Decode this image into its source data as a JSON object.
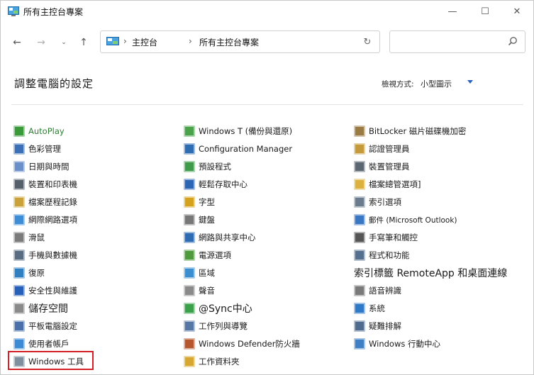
{
  "window": {
    "title": "所有主控台專案",
    "min_glyph": "—",
    "max_glyph": "☐",
    "close_glyph": "✕"
  },
  "nav": {
    "back_glyph": "←",
    "forward_glyph": "→",
    "recent_glyph": "⌄",
    "up_glyph": "↑",
    "breadcrumb": [
      "主控台",
      "所有主控台專案"
    ],
    "separator": "›",
    "refresh_glyph": "↻",
    "search_placeholder": ""
  },
  "header": {
    "title": "調整電腦的設定",
    "view_by_label": "檢視方式:",
    "view_by_value": "小型圖示"
  },
  "columns": [
    [
      {
        "label": "AutoPlay",
        "icon": "autoplay-icon",
        "color": "#3a9a3a",
        "style": "green"
      },
      {
        "label": "色彩管理",
        "icon": "color-management-icon",
        "color": "#3b6fb6"
      },
      {
        "label": "日期與時間",
        "icon": "clock-icon",
        "color": "#6a8fc9"
      },
      {
        "label": "裝置和印表機",
        "icon": "printer-icon",
        "color": "#55606b"
      },
      {
        "label": "檔案歷程記錄",
        "icon": "file-history-icon",
        "color": "#c9a23a"
      },
      {
        "label": "網際網路選項",
        "icon": "internet-options-icon",
        "color": "#3c8dd6"
      },
      {
        "label": "滑鼠",
        "icon": "mouse-icon",
        "color": "#7b7b7b"
      },
      {
        "label": "手機與數據機",
        "icon": "phone-modem-icon",
        "color": "#5a6c82"
      },
      {
        "label": "復原",
        "icon": "recovery-icon",
        "color": "#2f7fc1"
      },
      {
        "label": "安全性與維護",
        "icon": "flag-icon",
        "color": "#2660b8"
      },
      {
        "label": "儲存空間",
        "icon": "storage-icon",
        "color": "#8a8a8a",
        "style": "big"
      },
      {
        "label": "平板電腦設定",
        "icon": "tablet-icon",
        "color": "#4b6fa8"
      },
      {
        "label": "使用者帳戶",
        "icon": "user-accounts-icon",
        "color": "#3d8bd4"
      },
      {
        "label": "Windows 工具",
        "icon": "windows-tools-icon",
        "color": "#7f8f9e"
      }
    ],
    [
      {
        "label": "Windows T (備份與還原)",
        "icon": "backup-restore-icon",
        "color": "#4aa24a"
      },
      {
        "label": "Configuration Manager",
        "icon": "configuration-manager-icon",
        "color": "#2f6db3"
      },
      {
        "label": "預設程式",
        "icon": "default-programs-icon",
        "color": "#3f9a4a"
      },
      {
        "label": "輕鬆存取中心",
        "icon": "ease-of-access-icon",
        "color": "#2d65b5"
      },
      {
        "label": "字型",
        "icon": "fonts-icon",
        "color": "#d4a21c"
      },
      {
        "label": "鍵盤",
        "icon": "keyboard-icon",
        "color": "#777777"
      },
      {
        "label": "網路與共享中心",
        "icon": "network-sharing-icon",
        "color": "#2d6bb3"
      },
      {
        "label": "電源選項",
        "icon": "power-options-icon",
        "color": "#4f9a3c"
      },
      {
        "label": "區域",
        "icon": "region-icon",
        "color": "#3b8fd1"
      },
      {
        "label": "聲音",
        "icon": "sound-icon",
        "color": "#8a8a8a"
      },
      {
        "label": "@Sync中心",
        "icon": "sync-center-icon",
        "color": "#3aa04a",
        "style": "big"
      },
      {
        "label": "工作列與導覽",
        "icon": "taskbar-icon",
        "color": "#5677a3"
      },
      {
        "label": "Windows Defender防火牆",
        "icon": "firewall-icon",
        "color": "#b5562e"
      },
      {
        "label": "工作資料夾",
        "icon": "work-folders-icon",
        "color": "#d7a831"
      }
    ],
    [
      {
        "label": "BitLocker 磁片磁碟機加密",
        "icon": "bitlocker-icon",
        "color": "#9b7b44"
      },
      {
        "label": "認證管理員",
        "icon": "credential-manager-icon",
        "color": "#c59a3a"
      },
      {
        "label": "裝置管理員",
        "icon": "device-manager-icon",
        "color": "#5b6670"
      },
      {
        "label": "檔案總管選項]",
        "icon": "file-explorer-options-icon",
        "color": "#dcb23f"
      },
      {
        "label": "索引選項",
        "icon": "indexing-options-icon",
        "color": "#6a7c8e"
      },
      {
        "label": "郵件 (Microsoft Outlook)",
        "icon": "mail-icon",
        "color": "#3a77c2",
        "style": "sm"
      },
      {
        "label": "手寫筆和觸控",
        "icon": "pen-touch-icon",
        "color": "#555555"
      },
      {
        "label": "程式和功能",
        "icon": "programs-features-icon",
        "color": "#55708f"
      },
      {
        "label": "索引標籤 RemoteApp 和桌面連線",
        "icon": "",
        "color": "",
        "style": "big"
      },
      {
        "label": "語音辨識",
        "icon": "speech-recognition-icon",
        "color": "#7a7a7a"
      },
      {
        "label": "系統",
        "icon": "system-icon",
        "color": "#2f79c6"
      },
      {
        "label": "疑難排解",
        "icon": "troubleshooting-icon",
        "color": "#4f6b8e"
      },
      {
        "label": "Windows 行動中心",
        "icon": "mobility-center-icon",
        "color": "#3f7fc4"
      }
    ]
  ]
}
